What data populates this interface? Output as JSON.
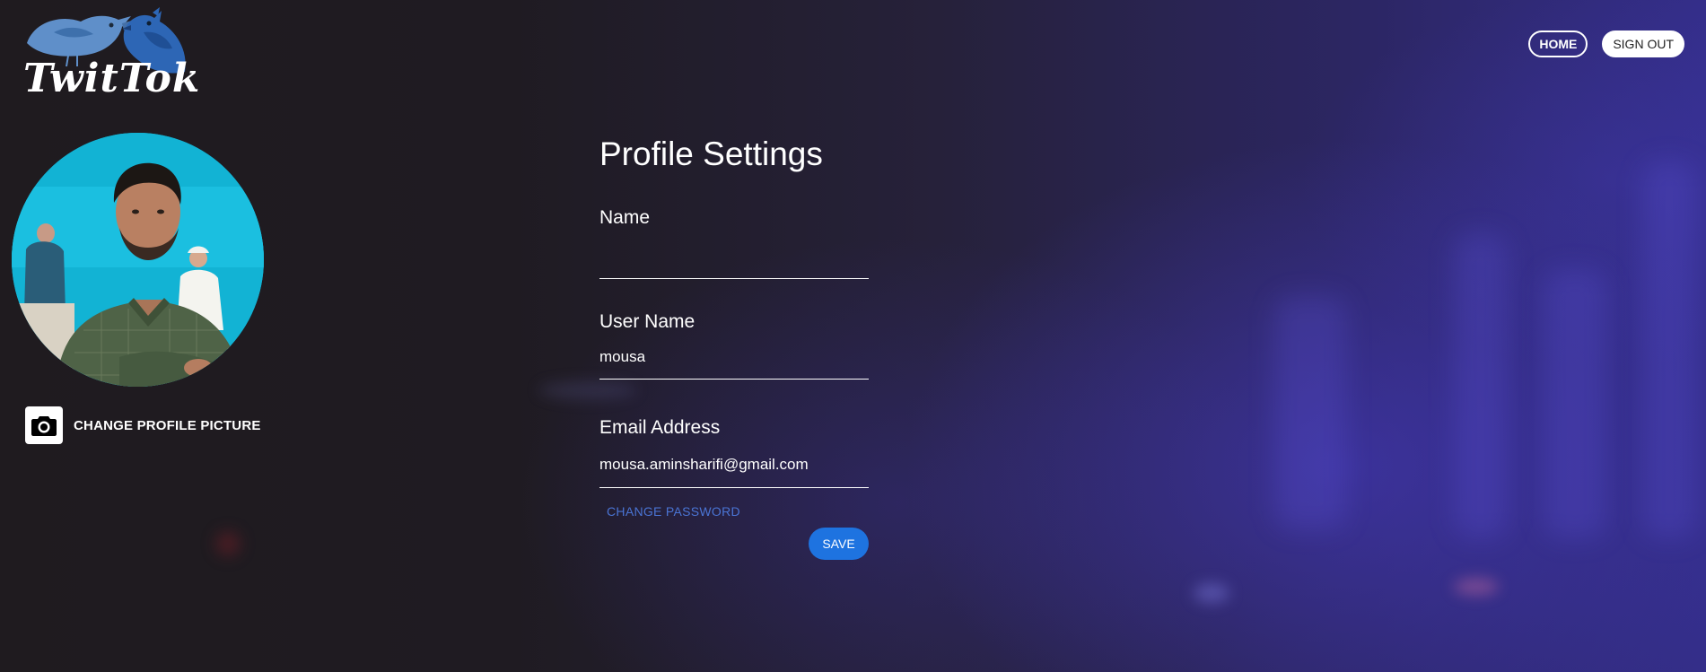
{
  "app": {
    "logo_text": "TwitTok"
  },
  "header": {
    "home_label": "HOME",
    "signout_label": "SIGN OUT"
  },
  "profile": {
    "change_picture_label": "CHANGE PROFILE PICTURE"
  },
  "form": {
    "title": "Profile Settings",
    "name": {
      "label": "Name",
      "value": ""
    },
    "username": {
      "label": "User Name",
      "value": "mousa"
    },
    "email": {
      "label": "Email Address",
      "value": "mousa.aminsharifi@gmail.com"
    },
    "change_password_label": "CHANGE PASSWORD",
    "save_label": "SAVE"
  },
  "colors": {
    "accent": "#1e73e0",
    "link": "#4a74d4",
    "background": "#1e1a1e"
  },
  "icons": {
    "camera": "camera-icon",
    "logo": "bird-logo-icon"
  }
}
